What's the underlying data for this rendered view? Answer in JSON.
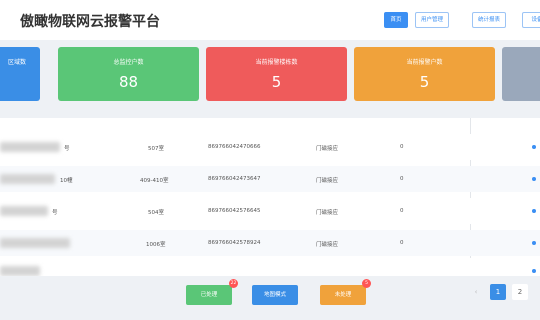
{
  "header": {
    "title": "傲瞰物联网云报警平台",
    "nav": [
      {
        "label": "首页",
        "active": true
      },
      {
        "label": "用户管理",
        "active": false
      },
      {
        "label": "统计报表",
        "active": false
      },
      {
        "label": "设备",
        "active": false
      }
    ]
  },
  "cards": [
    {
      "label": "区域数",
      "value": "",
      "color": "#3a8ee6"
    },
    {
      "label": "总监控户数",
      "value": "88",
      "color": "#5ac677"
    },
    {
      "label": "当前报警楼栋数",
      "value": "5",
      "color": "#ef5b5b"
    },
    {
      "label": "当前报警户数",
      "value": "5",
      "color": "#f0a23b"
    },
    {
      "label": "",
      "value": "",
      "color": "#9aa8bb"
    }
  ],
  "table": {
    "rows": [
      {
        "location": "号",
        "room": "507室",
        "device_id": "869766042470666",
        "type": "门磁接应",
        "count": "0"
      },
      {
        "location": "10幢",
        "room": "409-410室",
        "device_id": "869766042473647",
        "type": "门磁接应",
        "count": "0"
      },
      {
        "location": "号",
        "room": "504室",
        "device_id": "869766042576645",
        "type": "门磁接应",
        "count": "0"
      },
      {
        "location": "",
        "room": "1006室",
        "device_id": "869766042578924",
        "type": "门磁接应",
        "count": "0"
      },
      {
        "location": "",
        "room": "",
        "device_id": "",
        "type": "",
        "count": ""
      }
    ]
  },
  "footer": {
    "buttons": [
      {
        "label": "已处理",
        "badge": "22",
        "color": "#5ac677"
      },
      {
        "label": "地图模式",
        "badge": "",
        "color": "#3a8ee6"
      },
      {
        "label": "未处理",
        "badge": "5",
        "color": "#f0a23b"
      }
    ],
    "pagination": {
      "prev": "‹",
      "current": "1",
      "next": "2"
    }
  }
}
